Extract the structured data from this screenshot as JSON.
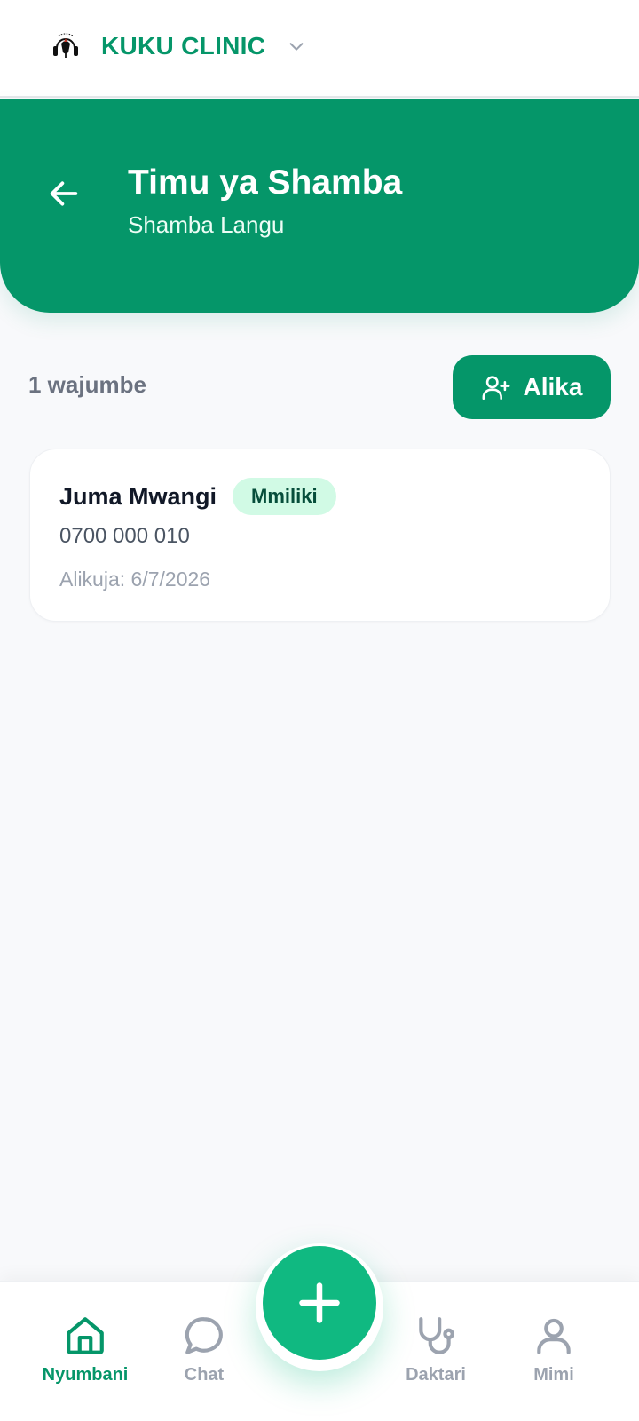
{
  "app": {
    "name": "KUKU CLINIC",
    "logo_icon": "rooster-logo-icon",
    "switcher_icon": "chevron-down-icon"
  },
  "header": {
    "title": "Timu ya Shamba",
    "subtitle": "Shamba Langu",
    "back_icon": "arrow-left-icon"
  },
  "members_toolbar": {
    "count_text": "1 wajumbe",
    "invite_label": "Alika",
    "invite_icon": "user-plus-icon"
  },
  "members": [
    {
      "name": "Juma Mwangi",
      "role": "Mmiliki",
      "phone": "0700 000 010",
      "joined": "Alikuja: 6/7/2026"
    }
  ],
  "bottom_nav": {
    "items": [
      {
        "label": "Nyumbani",
        "icon": "home-icon",
        "active": true
      },
      {
        "label": "Chat",
        "icon": "chat-bubble-icon",
        "active": false
      },
      {
        "label": "Daktari",
        "icon": "stethoscope-icon",
        "active": false
      },
      {
        "label": "Mimi",
        "icon": "user-icon",
        "active": false
      }
    ],
    "fab_icon": "plus-icon"
  },
  "colors": {
    "primary": "#059669",
    "primary_light": "#10b981",
    "badge_bg": "#d1fae5",
    "background": "#f8f9fb",
    "muted_text": "#9ca3af"
  }
}
